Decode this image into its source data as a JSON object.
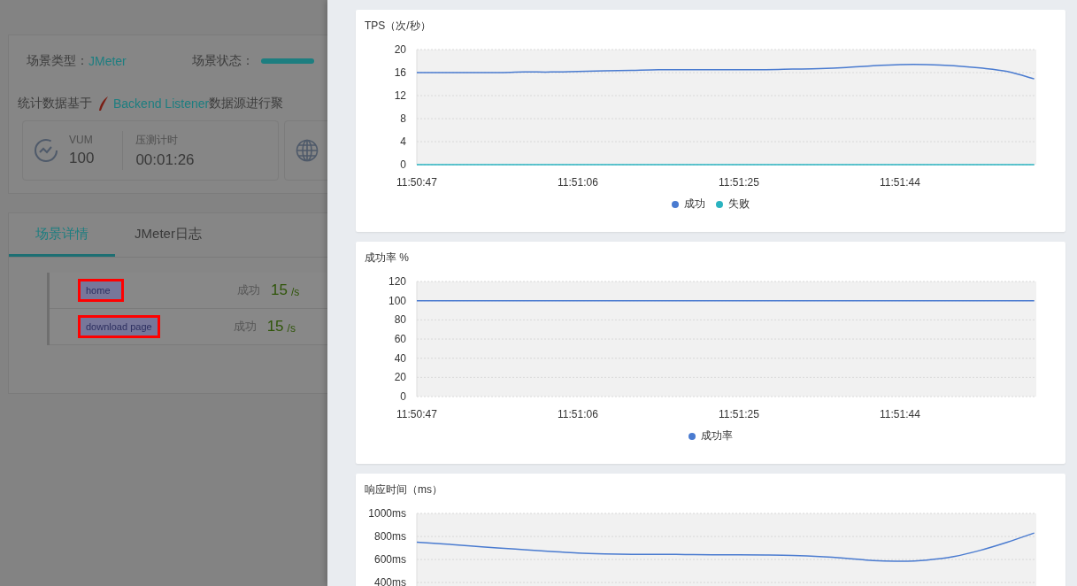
{
  "scenario": {
    "type_label": "场景类型：",
    "type_value": "JMeter",
    "status_label": "场景状态：",
    "source_prefix": "统计数据基于",
    "source_link": "Backend Listener",
    "source_suffix": "数据源进行聚",
    "stats": [
      {
        "label": "VUM",
        "value": "100"
      },
      {
        "label": "压测计时",
        "value": "00:01:26"
      }
    ]
  },
  "tabs": [
    {
      "label": "场景详情",
      "selected": true
    },
    {
      "label": "JMeter日志",
      "selected": false
    }
  ],
  "requests": [
    {
      "name": "home",
      "status": "成功",
      "value": "15",
      "unit": "/s"
    },
    {
      "name": "download page",
      "status": "成功",
      "value": "15",
      "unit": "/s"
    }
  ],
  "charts": [
    {
      "chart_data": {
        "type": "line",
        "grid": true,
        "title": "TPS（次/秒）",
        "categories": [
          "11:50:47",
          null,
          null,
          null,
          null,
          null,
          "11:51:06",
          null,
          null,
          null,
          null,
          null,
          "11:51:25",
          null,
          null,
          null,
          null,
          null,
          "11:51:44",
          null,
          null,
          null,
          null,
          null
        ],
        "ylim": [
          0,
          20
        ],
        "yticks": [
          0,
          4,
          8,
          12,
          16,
          20
        ],
        "series": [
          {
            "name": "成功",
            "color": "#4a7bd0",
            "values": [
              16,
              16,
              16,
              16,
              16.1,
              16.1,
              16.2,
              16.3,
              16.4,
              16.5,
              16.5,
              16.5,
              16.5,
              16.5,
              16.6,
              16.7,
              16.9,
              17.2,
              17.4,
              17.4,
              17.2,
              16.8,
              16.2,
              14.9
            ]
          },
          {
            "name": "失败",
            "color": "#2ab3c0",
            "values": [
              0,
              0,
              0,
              0,
              0,
              0,
              0,
              0,
              0,
              0,
              0,
              0,
              0,
              0,
              0,
              0,
              0,
              0,
              0,
              0,
              0,
              0,
              0,
              0
            ]
          }
        ]
      }
    },
    {
      "chart_data": {
        "type": "line",
        "grid": true,
        "title": "成功率 %",
        "categories": [
          "11:50:47",
          null,
          null,
          null,
          null,
          null,
          "11:51:06",
          null,
          null,
          null,
          null,
          null,
          "11:51:25",
          null,
          null,
          null,
          null,
          null,
          "11:51:44",
          null,
          null,
          null,
          null,
          null
        ],
        "ylim": [
          0,
          120
        ],
        "yticks": [
          0,
          20,
          40,
          60,
          80,
          100,
          120
        ],
        "series": [
          {
            "name": "成功率",
            "color": "#4a7bd0",
            "values": [
              100,
              100,
              100,
              100,
              100,
              100,
              100,
              100,
              100,
              100,
              100,
              100,
              100,
              100,
              100,
              100,
              100,
              100,
              100,
              100,
              100,
              100,
              100,
              100
            ]
          }
        ]
      }
    },
    {
      "chart_data": {
        "type": "line",
        "grid": true,
        "title": "响应时间（ms）",
        "ylim": [
          0,
          1000
        ],
        "yticks": [
          {
            "value": 400,
            "label": "400ms"
          },
          {
            "value": 600,
            "label": "600ms"
          },
          {
            "value": 800,
            "label": "800ms"
          },
          {
            "value": 1000,
            "label": "1000ms"
          }
        ],
        "series": [
          {
            "color": "#4a7bd0",
            "values": [
              750,
              735,
              718,
              700,
              685,
              670,
              655,
              648,
              645,
              645,
              643,
              641,
              640,
              638,
              634,
              625,
              610,
              590,
              585,
              595,
              625,
              680,
              750,
              830
            ]
          }
        ]
      }
    }
  ]
}
